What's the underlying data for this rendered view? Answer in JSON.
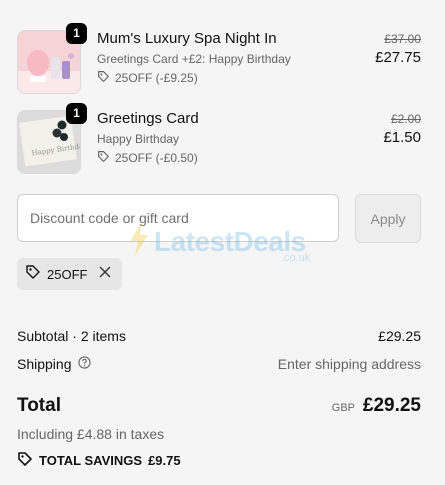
{
  "items": [
    {
      "quantity": "1",
      "title": "Mum's Luxury Spa Night In",
      "subtitle": "Greetings Card +£2: Happy Birthday",
      "discount": "25OFF (-£9.25)",
      "original_price": "£37.00",
      "price": "£27.75"
    },
    {
      "quantity": "1",
      "title": "Greetings Card",
      "subtitle": "Happy Birthday",
      "discount": "25OFF (-£0.50)",
      "original_price": "£2.00",
      "price": "£1.50"
    }
  ],
  "discount": {
    "placeholder": "Discount code or gift card",
    "apply_label": "Apply",
    "applied_code": "25OFF"
  },
  "watermark": {
    "text": "LatestDeals",
    "sub": ".co.uk"
  },
  "summary": {
    "subtotal_label": "Subtotal · 2 items",
    "subtotal_value": "£29.25",
    "shipping_label": "Shipping",
    "shipping_value": "Enter shipping address",
    "total_label": "Total",
    "currency": "GBP",
    "total_value": "£29.25",
    "taxes_note": "Including £4.88 in taxes",
    "savings_label": "TOTAL SAVINGS",
    "savings_value": "£9.75"
  }
}
